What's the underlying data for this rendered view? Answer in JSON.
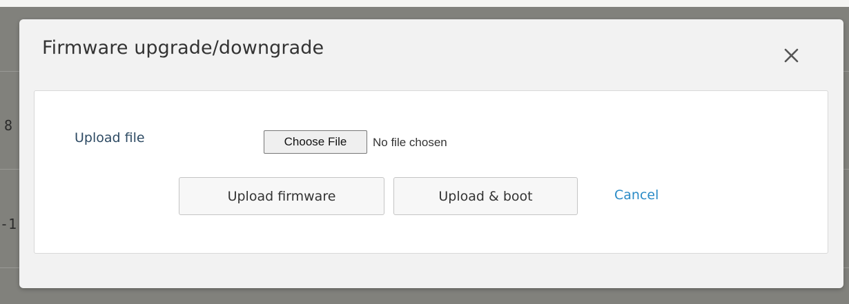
{
  "background": {
    "row_fragments": [
      "8",
      "-1"
    ]
  },
  "modal": {
    "title": "Firmware upgrade/downgrade",
    "close_icon": "close-icon",
    "upload_file_label": "Upload file",
    "choose_file_label": "Choose File",
    "file_status": "No file chosen",
    "upload_firmware_label": "Upload firmware",
    "upload_boot_label": "Upload & boot",
    "cancel_label": "Cancel"
  },
  "colors": {
    "overlay": "#81817c",
    "modal_bg": "#f2f2f2",
    "panel_bg": "#ffffff",
    "label_text": "#2d4a63",
    "link": "#2a8bc7"
  }
}
